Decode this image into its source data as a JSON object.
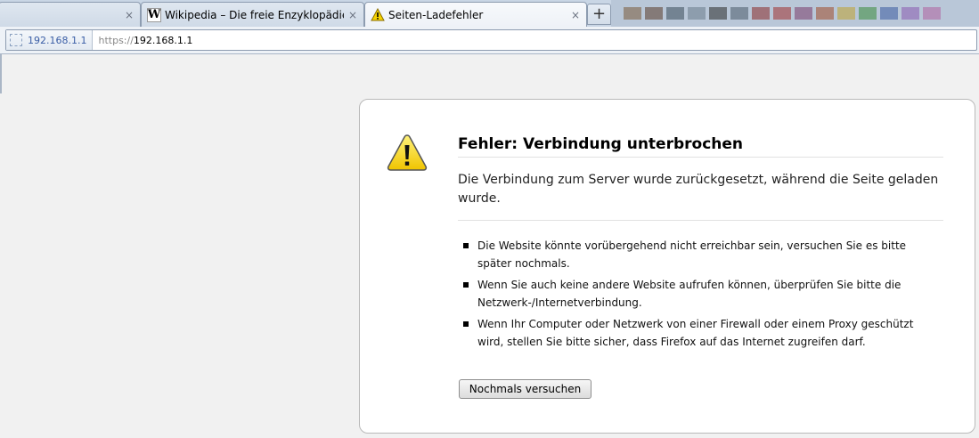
{
  "tabs": [
    {
      "title": "",
      "close": "×"
    },
    {
      "title": "Wikipedia – Die freie Enzyklopädie",
      "favicon_letter": "W",
      "close": "×"
    },
    {
      "title": "Seiten-Ladefehler",
      "close": "×"
    }
  ],
  "new_tab_label": "+",
  "navbar": {
    "identity_label": "192.168.1.1",
    "url_scheme": "https://",
    "url_host": "192.168.1.1"
  },
  "error": {
    "icon": "warning-icon",
    "title": "Fehler: Verbindung unterbrochen",
    "short_desc": "Die Verbindung zum Server wurde zurückgesetzt, während die Seite geladen wurde.",
    "items": [
      "Die Website könnte vorübergehend nicht erreichbar sein, versuchen Sie es bitte später nochmals.",
      "Wenn Sie auch keine andere Website aufrufen können, überprüfen Sie bitte die Netzwerk-/Internetverbindung.",
      "Wenn Ihr Computer oder Netzwerk von einer Firewall oder einem Proxy geschützt wird, stellen Sie bitte sicher, dass Firefox auf das Internet zugreifen darf."
    ],
    "retry_label": "Nochmals versuchen"
  },
  "colors": {
    "warning_yellow": "#f5d300",
    "identity_text": "#3a5ea6"
  }
}
